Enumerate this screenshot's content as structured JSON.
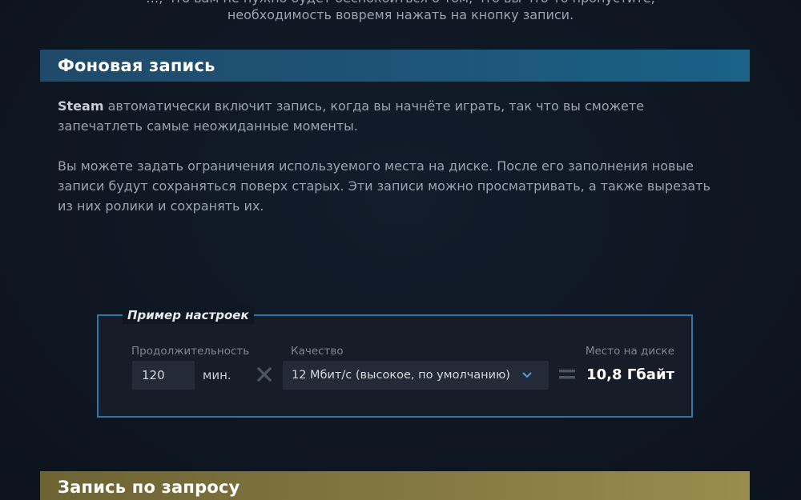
{
  "intro": {
    "line1": "…, что вам не нужно будет беспокоиться о том, что вы что-то пропустите,",
    "line2": "необходимость вовремя нажать на кнопку записи."
  },
  "background_section": {
    "title": "Фоновая запись",
    "p1_brand": "Steam",
    "p1_text": " автоматически включит запись, когда вы начнёте играть, так что вы сможете запечатлеть самые неожиданные моменты.",
    "p2_text": "Вы можете задать ограничения используемого места на диске. После его заполнения новые записи будут сохраняться поверх старых. Эти записи можно просматривать, а также вырезать из них ролики и сохранять их."
  },
  "example_settings": {
    "legend": "Пример настроек",
    "duration_label": "Продолжительность",
    "duration_value": "120",
    "duration_unit": "мин.",
    "quality_label": "Качество",
    "quality_value": "12 Мбит/с (высокое, по умолчанию)",
    "space_label": "Место на диске",
    "space_value": "10,8 Гбайт",
    "icons": {
      "multiply": "times-icon",
      "dropdown": "chevron-down-icon",
      "equals": "equals-icon"
    }
  },
  "on_demand_section": {
    "title": "Запись по запросу"
  },
  "colors": {
    "accent_blue": "#2f78a6",
    "header_blue": "#1d5578",
    "header_gold": "#857942",
    "chevron_blue": "#4aa3e0"
  }
}
